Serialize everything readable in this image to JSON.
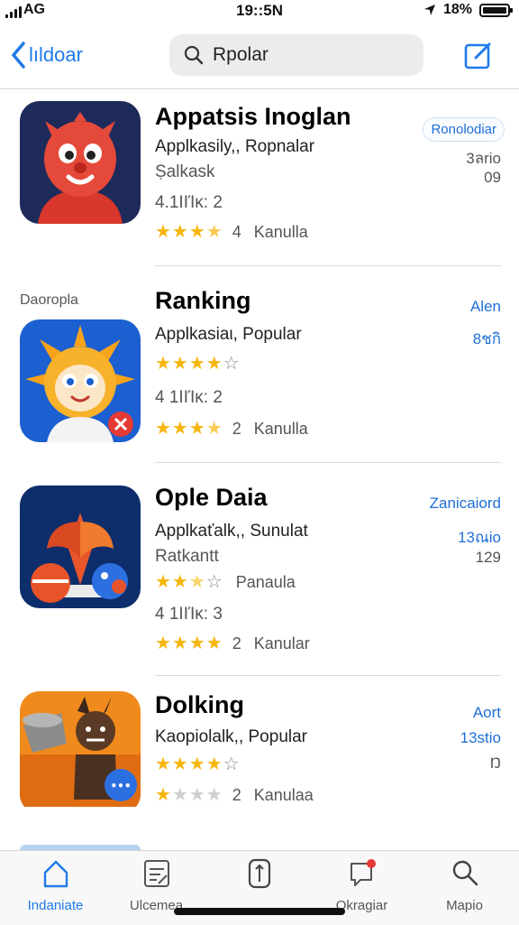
{
  "status": {
    "carrier": "AG",
    "time": "19::5N",
    "battery_pct": "18%"
  },
  "nav": {
    "back_label": "lıldoar",
    "search_text": "Rpolar"
  },
  "section_label": "Daoropla",
  "apps": [
    {
      "title": "Appatsis Inoglan",
      "subtitle": "Applkasily,, Ropnalar",
      "extra": "Ṣalkask",
      "rating_text": "4.1ΙΙΊκ: 2",
      "stars": {
        "filled": 3.5,
        "count": "4",
        "label": "Kanulla"
      },
      "right": {
        "pill": "Ronolodiar",
        "line1": "3ลrio",
        "line2": "09"
      }
    },
    {
      "title": "Ranking",
      "subtitle": "Applkasiaι, Popular",
      "rating_text": "4 1ΙΙΊκ: 2",
      "stars_top": {
        "filled": 4,
        "outline": 1
      },
      "stars": {
        "filled": 3.5,
        "count": "2",
        "label": "Kanulla"
      },
      "right": {
        "line1": "Alen",
        "line2": "8ชกิ"
      }
    },
    {
      "title": "Ople Daia",
      "subtitle": "Applkaťalk,, Sunulat",
      "extra": "Ratkantt",
      "rating_text": "4 1ΙΙΊκ: 3",
      "stars_top": {
        "filled": 2.5,
        "outline": 1,
        "label": "Panaula"
      },
      "stars": {
        "filled": 4,
        "count": "2",
        "label": "Kanular"
      },
      "right": {
        "line1": "Zanicaiord",
        "line2": "13ณio",
        "line3": "129"
      }
    },
    {
      "title": "Dolking",
      "subtitle": "Kaopiolalk,, Popular",
      "stars_top": {
        "filled": 4,
        "outline": 1
      },
      "stars": {
        "filled": 1,
        "count": "2",
        "label": "Kanulaa"
      },
      "right": {
        "line1": "Aort",
        "line2": "13stio",
        "line3": "Ŋ"
      }
    }
  ],
  "tabs": [
    {
      "label": "Indaniate",
      "icon": "home-icon"
    },
    {
      "label": "Ulcemea",
      "icon": "document-icon"
    },
    {
      "label": "",
      "icon": "phone-icon"
    },
    {
      "label": "Okragiar",
      "icon": "chat-icon"
    },
    {
      "label": "Mapio",
      "icon": "search-icon"
    }
  ],
  "colors": {
    "accent": "#1f7aea",
    "star": "#f7b60d"
  }
}
